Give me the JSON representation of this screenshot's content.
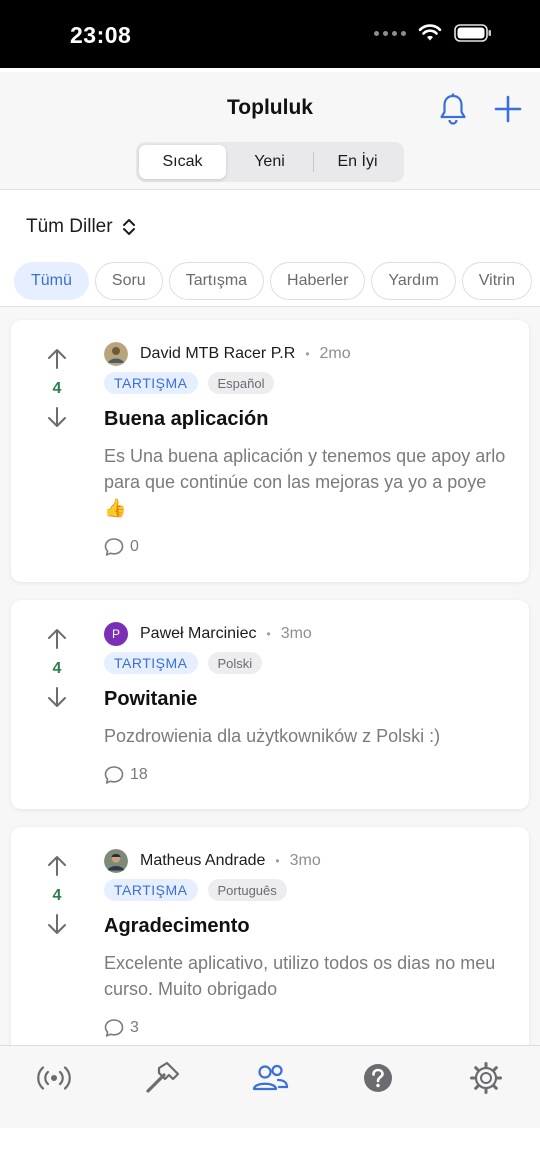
{
  "status": {
    "time": "23:08"
  },
  "header": {
    "title": "Topluluk"
  },
  "sort_tabs": [
    "Sıcak",
    "Yeni",
    "En İyi"
  ],
  "language_filter": {
    "label": "Tüm Diller"
  },
  "chips": [
    "Tümü",
    "Soru",
    "Tartışma",
    "Haberler",
    "Yardım",
    "Vitrin"
  ],
  "posts": [
    {
      "votes": "4",
      "author": "David MTB Racer P.R",
      "time": "2mo",
      "category": "TARTIŞMA",
      "language": "Español",
      "title": "Buena aplicación",
      "excerpt": "Es Una buena aplicación y tenemos que apoy arlo para que continúe con las mejoras ya yo a poye 👍",
      "comments": "0"
    },
    {
      "votes": "4",
      "author": "Paweł Marciniec",
      "avatar_letter": "P",
      "time": "3mo",
      "category": "TARTIŞMA",
      "language": "Polski",
      "title": "Powitanie",
      "excerpt": "Pozdrowienia dla użytkowników z Polski :)",
      "comments": "18"
    },
    {
      "votes": "4",
      "author": "Matheus Andrade",
      "time": "3mo",
      "category": "TARTIŞMA",
      "language": "Português",
      "title": "Agradecimento",
      "excerpt": "Excelente aplicativo, utilizo todos os dias no meu curso. Muito obrigado",
      "comments": "3"
    }
  ],
  "tabbar": {
    "items": [
      "broadcast-icon",
      "hammer-icon",
      "community-icon",
      "help-icon",
      "settings-icon"
    ],
    "active": "community-icon"
  },
  "colors": {
    "accent": "#3b6fd9",
    "vote": "#2e7d4f",
    "avatar_purple": "#7b2fb5"
  }
}
